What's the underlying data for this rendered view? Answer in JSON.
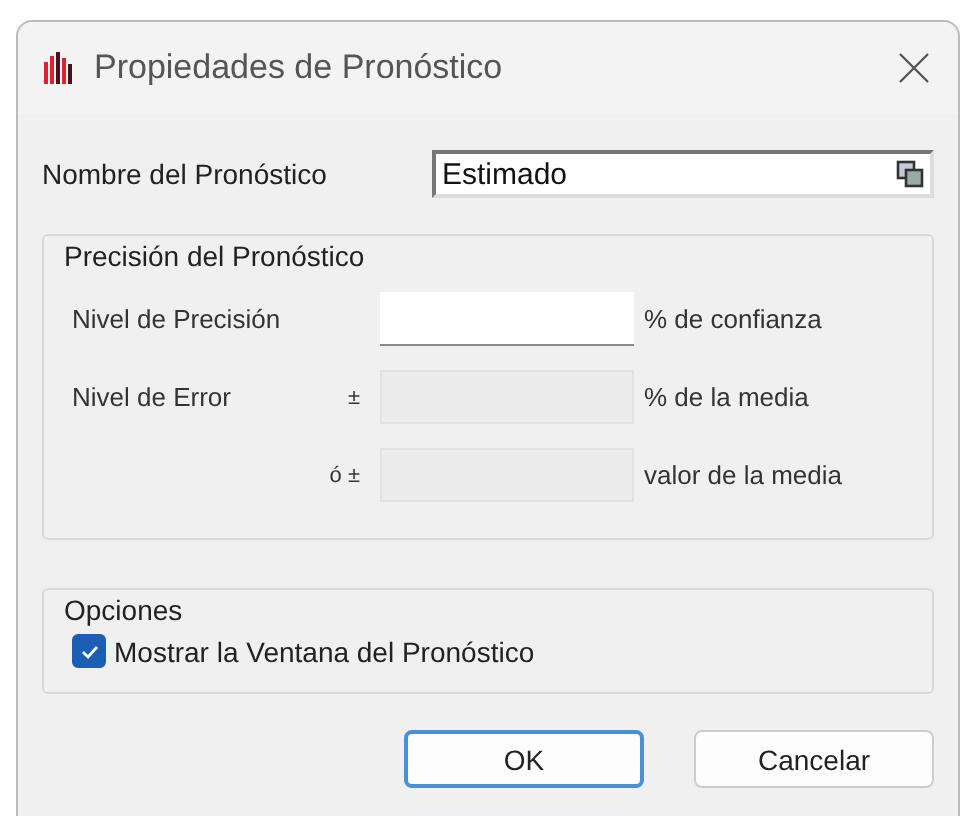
{
  "window": {
    "title": "Propiedades de Pronóstico"
  },
  "name_field": {
    "label": "Nombre del Pronóstico",
    "value": "Estimado"
  },
  "precision_group": {
    "title": "Precisión del Pronóstico",
    "rows": [
      {
        "label": "Nivel de Precisión",
        "sign": "",
        "disabled": false,
        "unit": "% de confianza"
      },
      {
        "label": "Nivel de Error",
        "sign": "±",
        "disabled": true,
        "unit": "% de la media"
      },
      {
        "label": "",
        "sign": "ó ±",
        "disabled": true,
        "unit": "valor de la media"
      }
    ]
  },
  "options_group": {
    "title": "Opciones",
    "checkbox": {
      "label": "Mostrar la Ventana del Pronóstico",
      "checked": true
    }
  },
  "buttons": [
    {
      "label": "OK",
      "default": true
    },
    {
      "label": "Cancelar",
      "default": false
    }
  ]
}
